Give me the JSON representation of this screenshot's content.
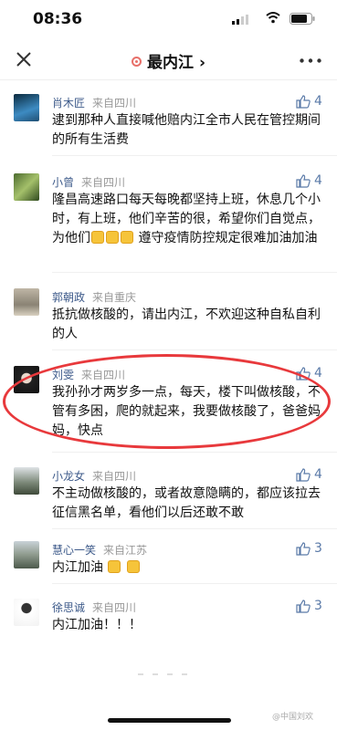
{
  "status_bar": {
    "time": "08:36"
  },
  "nav": {
    "title": "最内江",
    "chevron": "›"
  },
  "comments": [
    {
      "user": "肖木匠",
      "from": "来自四川",
      "likes": "4",
      "text": "逮到那种人直接喊他赔内江全市人民在管控期间的所有生活费"
    },
    {
      "user": "小曾",
      "from": "来自四川",
      "likes": "4",
      "text_a": "隆昌高速路口每天每晚都坚持上班，休息几个小时，有上班，他们辛苦的很，希望你们自觉点，为他们",
      "text_b": " 遵守疫情防控规定很难加油加油"
    },
    {
      "user": "郭朝政",
      "from": "来自重庆",
      "likes": "",
      "text": "抵抗做核酸的，请出内江，不欢迎这种自私自利的人"
    },
    {
      "user": "刘雯",
      "from": "来自四川",
      "likes": "4",
      "text": "我孙孙才两岁多一点，每天，楼下叫做核酸，不管有多困，爬的就起来，我要做核酸了，爸爸妈妈，快点"
    },
    {
      "user": "小龙女",
      "from": "来自四川",
      "likes": "4",
      "text": "不主动做核酸的，或者故意隐瞒的，都应该拉去征信黑名单，看他们以后还敢不敢"
    },
    {
      "user": "慧心一笑",
      "from": "来自江苏",
      "likes": "3",
      "text": "内江加油"
    },
    {
      "user": "徐思诚",
      "from": "来自四川",
      "likes": "3",
      "text": "内江加油！！！"
    }
  ],
  "watermark": "@中国刘欢",
  "colors": {
    "username": "#3d5a8a",
    "like": "#5a7aa8",
    "annotation": "#e8393c"
  }
}
